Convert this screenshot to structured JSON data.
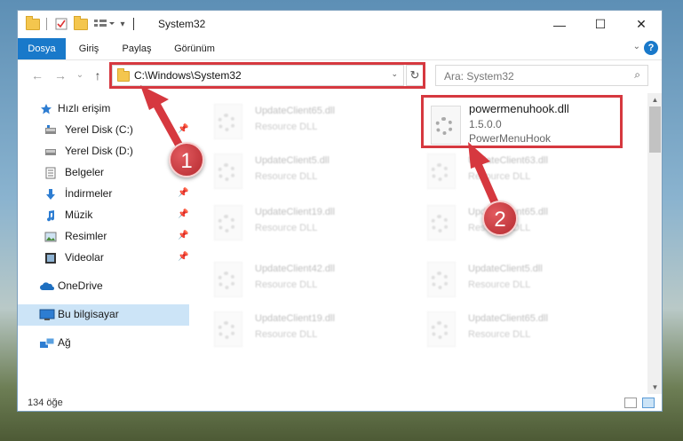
{
  "window": {
    "title": "System32",
    "minimize": "—",
    "maximize": "☐",
    "close": "✕"
  },
  "ribbon": {
    "tabs": [
      "Dosya",
      "Giriş",
      "Paylaş",
      "Görünüm"
    ],
    "collapse": "⌄",
    "help": "?"
  },
  "nav": {
    "back": "←",
    "forward": "→",
    "recent": "⌄",
    "up": "↑",
    "address": "C:\\Windows\\System32",
    "address_caret": "⌄",
    "refresh": "↻",
    "search_placeholder": "Ara: System32",
    "search_icon": "⌕"
  },
  "sidebar": {
    "items": [
      {
        "label": "Hızlı erişim",
        "icon": "star-icon",
        "pinned": false
      },
      {
        "label": "Yerel Disk (C:)",
        "icon": "drive-icon",
        "pinned": true
      },
      {
        "label": "Yerel Disk (D:)",
        "icon": "drive-icon",
        "pinned": false
      },
      {
        "label": "Belgeler",
        "icon": "documents-icon",
        "pinned": true
      },
      {
        "label": "İndirmeler",
        "icon": "download-icon",
        "pinned": true
      },
      {
        "label": "Müzik",
        "icon": "music-icon",
        "pinned": true
      },
      {
        "label": "Resimler",
        "icon": "pictures-icon",
        "pinned": true
      },
      {
        "label": "Videolar",
        "icon": "videos-icon",
        "pinned": true
      },
      {
        "label": "OneDrive",
        "icon": "cloud-icon",
        "pinned": false
      },
      {
        "label": "Bu bilgisayar",
        "icon": "computer-icon",
        "pinned": false,
        "selected": true
      },
      {
        "label": "Ağ",
        "icon": "network-icon",
        "pinned": false
      }
    ],
    "pin_glyph": "📌"
  },
  "files": {
    "left_column": [
      {
        "name": "UpdateClient65.dll",
        "type": "Resource DLL"
      },
      {
        "name": "UpdateClient5.dll",
        "type": "Resource DLL"
      },
      {
        "name": "UpdateClient19.dll",
        "type": "Resource DLL"
      },
      {
        "name": "UpdateClient42.dll",
        "type": "Resource DLL"
      },
      {
        "name": "UpdateClient19.dll",
        "type": "Resource DLL"
      }
    ],
    "right_column": [
      {
        "name": "UpdateClient63.dll",
        "type": "Resource DLL"
      },
      {
        "name": "UpdateClient65.dll",
        "type": "Resource DLL"
      },
      {
        "name": "UpdateClient5.dll",
        "type": "Resource DLL"
      },
      {
        "name": "UpdateClient65.dll",
        "type": "Resource DLL"
      }
    ],
    "selected": {
      "name": "powermenuhook.dll",
      "version": "1.5.0.0",
      "description": "PowerMenuHook"
    }
  },
  "status": {
    "count": "134 öğe"
  },
  "callouts": [
    "1",
    "2"
  ],
  "colors": {
    "accent": "#1979ca",
    "highlight": "#d6383f",
    "selected_bg": "#cce4f7"
  }
}
